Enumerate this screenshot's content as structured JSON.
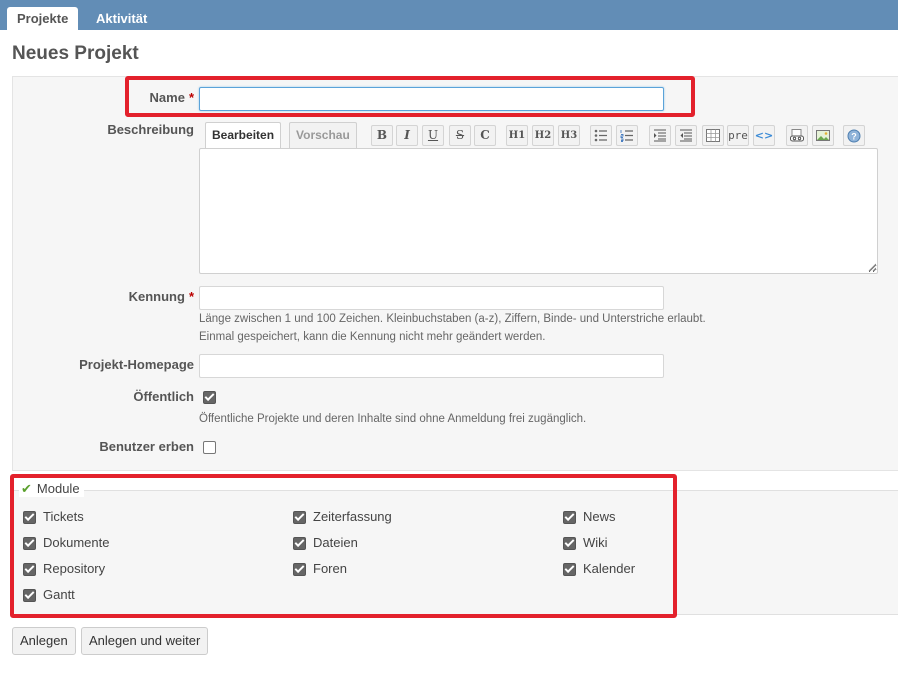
{
  "tabs": [
    {
      "label": "Projekte",
      "active": true
    },
    {
      "label": "Aktivität",
      "active": false
    }
  ],
  "page": {
    "title": "Neues Projekt"
  },
  "form": {
    "required_mark": "*",
    "name": {
      "label": "Name",
      "value": ""
    },
    "description": {
      "label": "Beschreibung",
      "tab_edit": "Bearbeiten",
      "tab_preview": "Vorschau",
      "value": "",
      "toolbar": [
        {
          "name": "bold-icon",
          "glyph": "B"
        },
        {
          "name": "italic-icon",
          "glyph": "I"
        },
        {
          "name": "underline-icon",
          "glyph": "U"
        },
        {
          "name": "strikethrough-icon",
          "glyph": "S"
        },
        {
          "name": "inline-code-icon",
          "glyph": "C"
        },
        {
          "name": "heading1-icon",
          "glyph": "H1"
        },
        {
          "name": "heading2-icon",
          "glyph": "H2"
        },
        {
          "name": "heading3-icon",
          "glyph": "H3"
        },
        {
          "name": "bullet-list-icon",
          "glyph": ""
        },
        {
          "name": "numbered-list-icon",
          "glyph": ""
        },
        {
          "name": "quote-icon",
          "glyph": ""
        },
        {
          "name": "unquote-icon",
          "glyph": ""
        },
        {
          "name": "table-icon",
          "glyph": ""
        },
        {
          "name": "preformatted-icon",
          "glyph": "pre"
        },
        {
          "name": "code-highlight-icon",
          "glyph": "<>"
        },
        {
          "name": "wiki-link-icon",
          "glyph": ""
        },
        {
          "name": "image-icon",
          "glyph": ""
        },
        {
          "name": "help-icon",
          "glyph": "?"
        }
      ]
    },
    "identifier": {
      "label": "Kennung",
      "value": "",
      "hint_line1": "Länge zwischen 1 und 100 Zeichen. Kleinbuchstaben (a-z), Ziffern, Binde- und Unterstriche erlaubt.",
      "hint_line2": "Einmal gespeichert, kann die Kennung nicht mehr geändert werden."
    },
    "homepage": {
      "label": "Projekt-Homepage",
      "value": ""
    },
    "public": {
      "label": "Öffentlich",
      "checked": true,
      "hint": "Öffentliche Projekte und deren Inhalte sind ohne Anmeldung frei zugänglich."
    },
    "inherit": {
      "label": "Benutzer erben",
      "checked": false
    }
  },
  "modules": {
    "legend": "Module",
    "items": [
      {
        "label": "Tickets",
        "checked": true
      },
      {
        "label": "Zeiterfassung",
        "checked": true
      },
      {
        "label": "News",
        "checked": true
      },
      {
        "label": "Dokumente",
        "checked": true
      },
      {
        "label": "Dateien",
        "checked": true
      },
      {
        "label": "Wiki",
        "checked": true
      },
      {
        "label": "Repository",
        "checked": true
      },
      {
        "label": "Foren",
        "checked": true
      },
      {
        "label": "Kalender",
        "checked": true
      },
      {
        "label": "Gantt",
        "checked": true
      }
    ]
  },
  "buttons": {
    "create": "Anlegen",
    "create_continue": "Anlegen und weiter"
  },
  "colors": {
    "header": "#628db6",
    "highlight": "#e3212c",
    "required": "#bb0000",
    "module_check": "#5aa02c"
  }
}
